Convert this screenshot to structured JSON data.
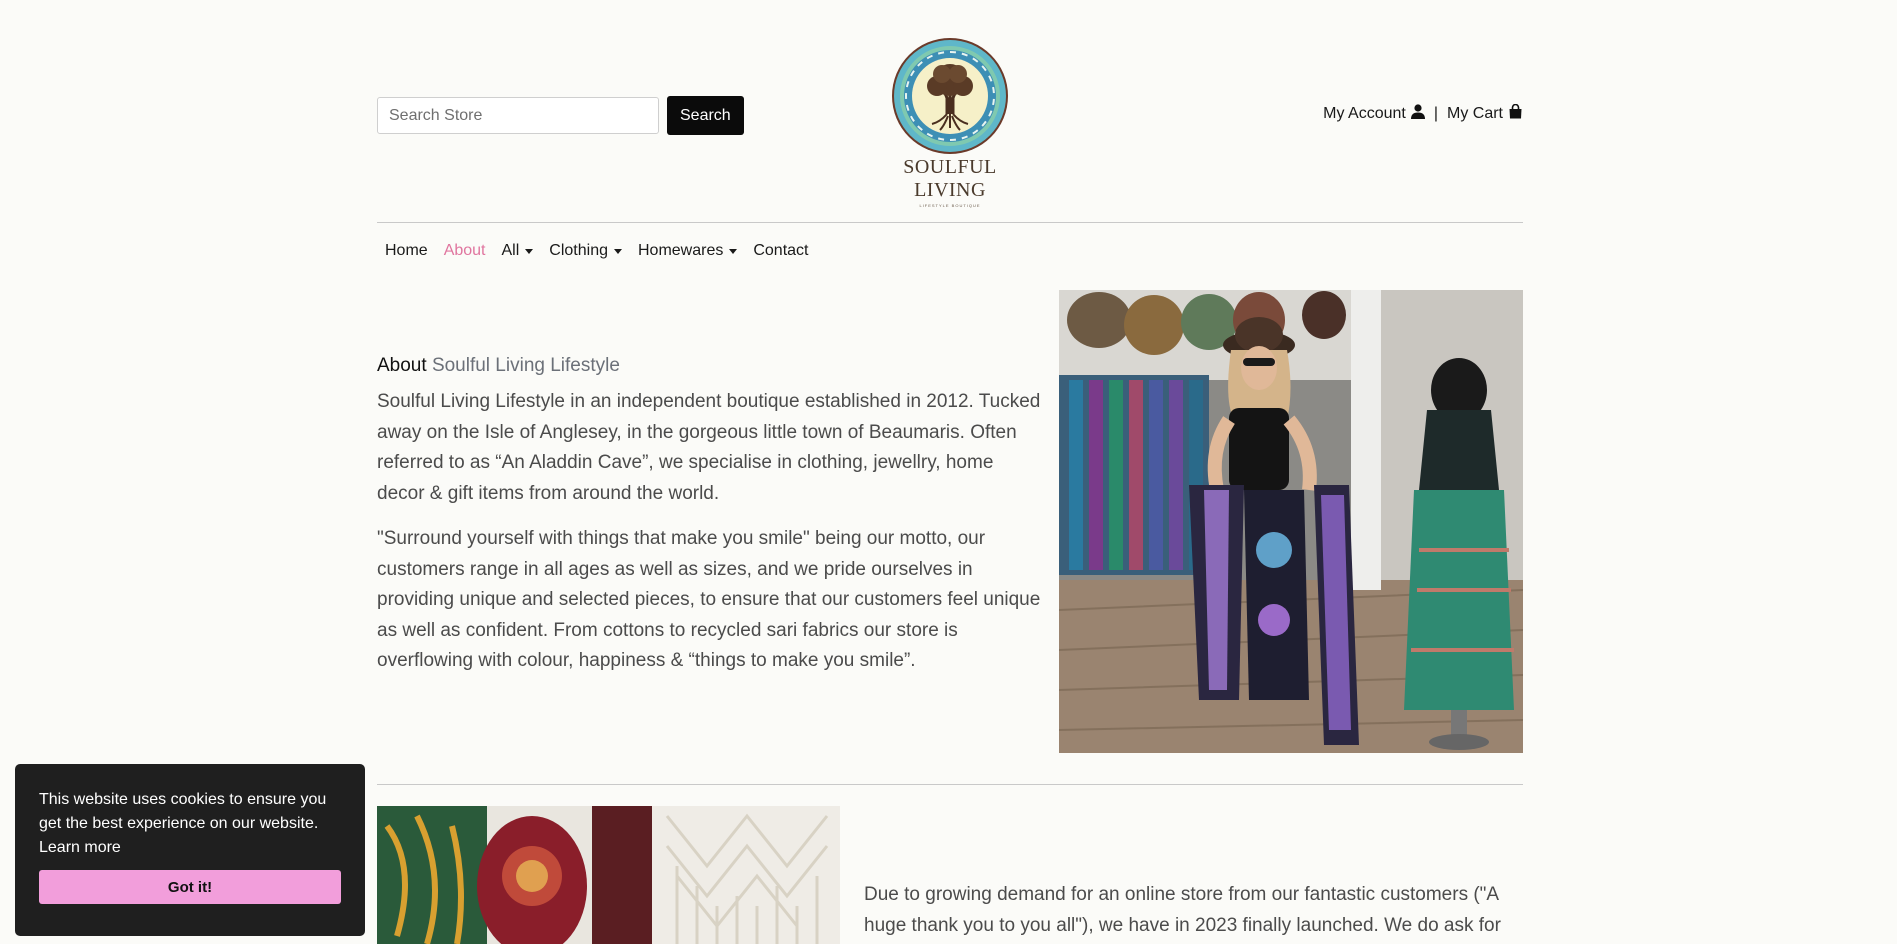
{
  "header": {
    "search_placeholder": "Search Store",
    "search_button": "Search",
    "logo": {
      "name": "SOULFUL LIVING",
      "tagline": "LIFESTYLE BOUTIQUE"
    },
    "account_label": "My Account",
    "separator": "|",
    "cart_label": "My Cart",
    "account_icon": "user-icon",
    "cart_icon": "shopping-bag-icon"
  },
  "nav": {
    "items": [
      {
        "label": "Home",
        "active": false,
        "dropdown": false
      },
      {
        "label": "About",
        "active": true,
        "dropdown": false
      },
      {
        "label": "All",
        "active": false,
        "dropdown": true
      },
      {
        "label": "Clothing",
        "active": false,
        "dropdown": true
      },
      {
        "label": "Homewares",
        "active": false,
        "dropdown": true
      },
      {
        "label": "Contact",
        "active": false,
        "dropdown": false
      }
    ]
  },
  "about": {
    "title_prefix": "About",
    "title_brand": "Soulful Living Lifestyle",
    "paragraph_1": "Soulful Living Lifestyle in an independent boutique established in 2012. Tucked away on the Isle of Anglesey, in the gorgeous little town of Beaumaris. Often referred to as “An Aladdin Cave”, we specialise in clothing, jewellry, home decor & gift items from around the world.",
    "paragraph_2": "\"Surround yourself with things that make you smile\" being our motto, our customers range in all ages as well as sizes, and we pride ourselves in providing unique and selected pieces, to ensure that our customers feel unique as well as confident. From cottons to recycled sari fabrics our store is overflowing with colour, happiness & “things to make you smile”."
  },
  "lower": {
    "paragraph": "Due to growing demand for an online store from our fantastic customers (\"A huge thank you to you all\"), we have in 2023 finally launched. We do ask for"
  },
  "cookie": {
    "message": "This website uses cookies to ensure you get the best experience on our website.",
    "link": "Learn more",
    "button": "Got it!"
  },
  "colors": {
    "accent_pink": "#e0759f",
    "cookie_button": "#f29edb",
    "cookie_bg": "#1f1f1f",
    "page_bg": "#fbfbf8"
  }
}
